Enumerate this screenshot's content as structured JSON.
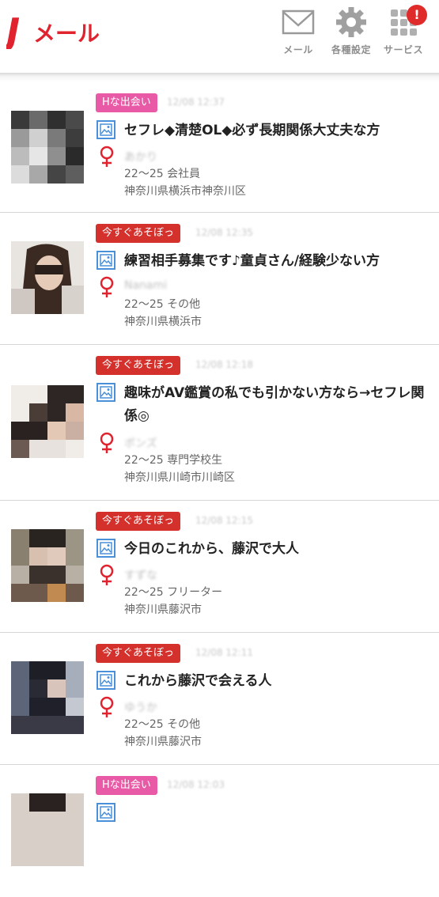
{
  "header": {
    "logo_text": "Jメール",
    "nav": [
      {
        "label": "メール",
        "icon": "mail-icon"
      },
      {
        "label": "各種設定",
        "icon": "gear-icon"
      },
      {
        "label": "サービス",
        "icon": "grid-icon",
        "badge": "!"
      }
    ]
  },
  "colors": {
    "brand": "#e0232e",
    "tag_pink": "#e85aa6",
    "tag_red": "#d4302c",
    "venus": "#e0232e",
    "pic_icon": "#4a90d9"
  },
  "posts": [
    {
      "tag": "Hな出会い",
      "tag_style": "pink",
      "time": "12/08 12:37",
      "title": "セフレ◆清楚OL◆必ず長期関係大丈夫な方",
      "user": "あかり",
      "age_job": "22～25 会社員",
      "location": "神奈川県横浜市神奈川区"
    },
    {
      "tag": "今すぐあそぼっ",
      "tag_style": "red",
      "time": "12/08 12:35",
      "title": "練習相手募集です♪童貞さん/経験少ない方",
      "user": "Nanami",
      "age_job": "22～25 その他",
      "location": "神奈川県横浜市"
    },
    {
      "tag": "今すぐあそぼっ",
      "tag_style": "red",
      "time": "12/08 12:18",
      "title": "趣味がAV鑑賞の私でも引かない方なら→セフレ関係◎",
      "user": "ポンズ",
      "age_job": "22～25 専門学校生",
      "location": "神奈川県川崎市川崎区"
    },
    {
      "tag": "今すぐあそぼっ",
      "tag_style": "red",
      "time": "12/08 12:15",
      "title": "今日のこれから、藤沢で大人",
      "user": "すずな",
      "age_job": "22～25 フリーター",
      "location": "神奈川県藤沢市"
    },
    {
      "tag": "今すぐあそぼっ",
      "tag_style": "red",
      "time": "12/08 12:11",
      "title": "これから藤沢で会える人",
      "user": "ゆうか",
      "age_job": "22～25 その他",
      "location": "神奈川県藤沢市"
    },
    {
      "tag": "Hな出会い",
      "tag_style": "pink",
      "time": "12/08 12:03",
      "title": "",
      "user": "",
      "age_job": "",
      "location": ""
    }
  ]
}
